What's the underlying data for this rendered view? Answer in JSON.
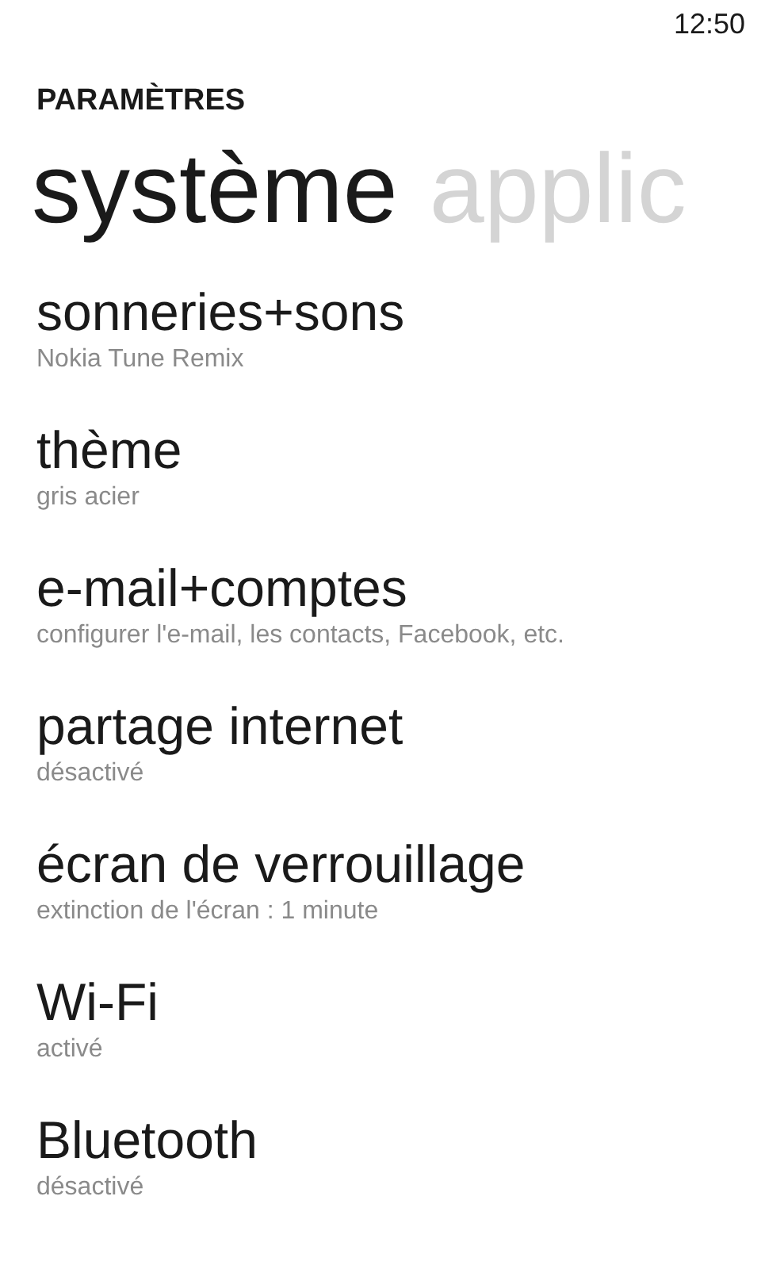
{
  "status_bar": {
    "time": "12:50"
  },
  "app_title": "PARAMÈTRES",
  "pivots": [
    {
      "label": "système",
      "selected": true
    },
    {
      "label": "applic",
      "selected": false
    }
  ],
  "items": [
    {
      "title": "sonneries+sons",
      "subtitle": "Nokia Tune Remix"
    },
    {
      "title": "thème",
      "subtitle": "gris acier"
    },
    {
      "title": "e-mail+comptes",
      "subtitle": "configurer l'e-mail, les contacts, Facebook, etc."
    },
    {
      "title": "partage internet",
      "subtitle": "désactivé"
    },
    {
      "title": "écran de verrouillage",
      "subtitle": "extinction de l'écran : 1 minute"
    },
    {
      "title": "Wi-Fi",
      "subtitle": "activé"
    },
    {
      "title": "Bluetooth",
      "subtitle": "désactivé"
    }
  ]
}
